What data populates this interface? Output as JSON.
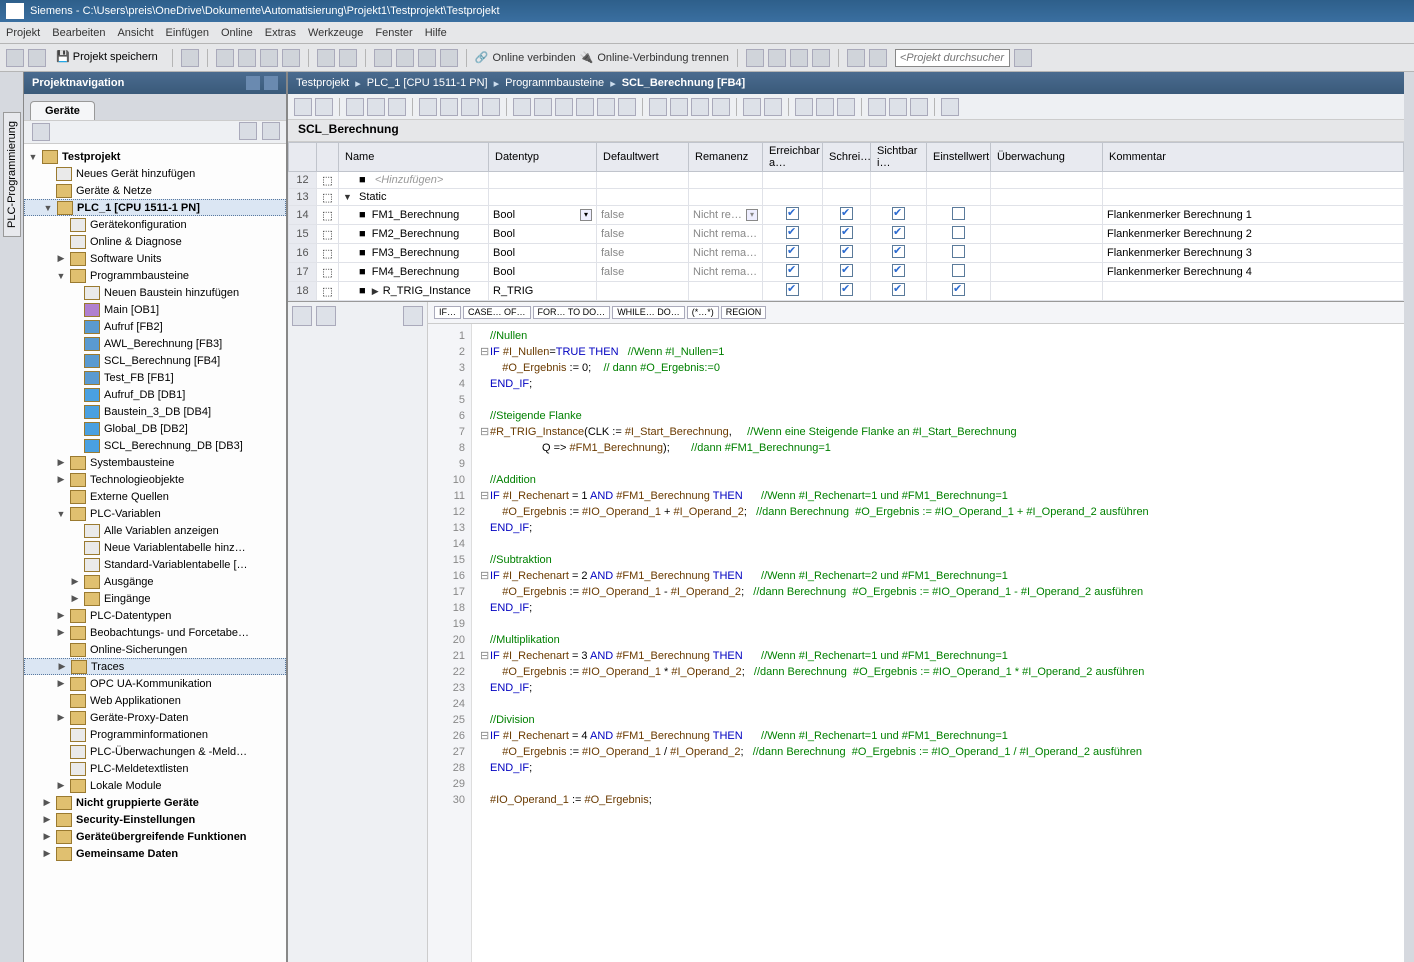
{
  "title": "Siemens  -  C:\\Users\\preis\\OneDrive\\Dokumente\\Automatisierung\\Projekt1\\Testprojekt\\Testprojekt",
  "menu": [
    "Projekt",
    "Bearbeiten",
    "Ansicht",
    "Einfügen",
    "Online",
    "Extras",
    "Werkzeuge",
    "Fenster",
    "Hilfe"
  ],
  "toolbar": {
    "save_label": "Projekt speichern",
    "online_verbinden": "Online verbinden",
    "online_trennen": "Online-Verbindung trennen",
    "search_placeholder": "<Projekt durchsucher"
  },
  "nav": {
    "header": "Projektnavigation",
    "tab": "Geräte"
  },
  "tree": [
    {
      "ind": 0,
      "exp": "▼",
      "icon": "folder",
      "label": "Testprojekt",
      "bold": true
    },
    {
      "ind": 1,
      "exp": "",
      "icon": "add",
      "label": "Neues Gerät hinzufügen"
    },
    {
      "ind": 1,
      "exp": "",
      "icon": "folder",
      "label": "Geräte & Netze"
    },
    {
      "ind": 1,
      "exp": "▼",
      "icon": "folder",
      "label": "PLC_1 [CPU 1511-1 PN]",
      "bold": true,
      "sel": true
    },
    {
      "ind": 2,
      "exp": "",
      "icon": "add",
      "label": "Gerätekonfiguration"
    },
    {
      "ind": 2,
      "exp": "",
      "icon": "add",
      "label": "Online & Diagnose"
    },
    {
      "ind": 2,
      "exp": "▶",
      "icon": "folder",
      "label": "Software Units"
    },
    {
      "ind": 2,
      "exp": "▼",
      "icon": "folder",
      "label": "Programmbausteine"
    },
    {
      "ind": 3,
      "exp": "",
      "icon": "add",
      "label": "Neuen Baustein hinzufügen"
    },
    {
      "ind": 3,
      "exp": "",
      "icon": "ob",
      "label": "Main [OB1]"
    },
    {
      "ind": 3,
      "exp": "",
      "icon": "fb",
      "label": "Aufruf [FB2]"
    },
    {
      "ind": 3,
      "exp": "",
      "icon": "fb",
      "label": "AWL_Berechnung [FB3]"
    },
    {
      "ind": 3,
      "exp": "",
      "icon": "fb",
      "label": "SCL_Berechnung [FB4]"
    },
    {
      "ind": 3,
      "exp": "",
      "icon": "fb",
      "label": "Test_FB [FB1]"
    },
    {
      "ind": 3,
      "exp": "",
      "icon": "db",
      "label": "Aufruf_DB [DB1]"
    },
    {
      "ind": 3,
      "exp": "",
      "icon": "db",
      "label": "Baustein_3_DB [DB4]"
    },
    {
      "ind": 3,
      "exp": "",
      "icon": "db",
      "label": "Global_DB [DB2]"
    },
    {
      "ind": 3,
      "exp": "",
      "icon": "db",
      "label": "SCL_Berechnung_DB [DB3]"
    },
    {
      "ind": 2,
      "exp": "▶",
      "icon": "folder",
      "label": "Systembausteine"
    },
    {
      "ind": 2,
      "exp": "▶",
      "icon": "folder",
      "label": "Technologieobjekte"
    },
    {
      "ind": 2,
      "exp": "",
      "icon": "folder",
      "label": "Externe Quellen"
    },
    {
      "ind": 2,
      "exp": "▼",
      "icon": "folder",
      "label": "PLC-Variablen"
    },
    {
      "ind": 3,
      "exp": "",
      "icon": "add",
      "label": "Alle Variablen anzeigen"
    },
    {
      "ind": 3,
      "exp": "",
      "icon": "add",
      "label": "Neue Variablentabelle hinz…"
    },
    {
      "ind": 3,
      "exp": "",
      "icon": "add",
      "label": "Standard-Variablentabelle […"
    },
    {
      "ind": 3,
      "exp": "▶",
      "icon": "folder",
      "label": "Ausgänge"
    },
    {
      "ind": 3,
      "exp": "▶",
      "icon": "folder",
      "label": "Eingänge"
    },
    {
      "ind": 2,
      "exp": "▶",
      "icon": "folder",
      "label": "PLC-Datentypen"
    },
    {
      "ind": 2,
      "exp": "▶",
      "icon": "folder",
      "label": "Beobachtungs- und Forcetabe…"
    },
    {
      "ind": 2,
      "exp": "",
      "icon": "folder",
      "label": "Online-Sicherungen"
    },
    {
      "ind": 2,
      "exp": "▶",
      "icon": "folder",
      "label": "Traces",
      "sel": true
    },
    {
      "ind": 2,
      "exp": "▶",
      "icon": "folder",
      "label": "OPC UA-Kommunikation"
    },
    {
      "ind": 2,
      "exp": "",
      "icon": "folder",
      "label": "Web Applikationen"
    },
    {
      "ind": 2,
      "exp": "▶",
      "icon": "folder",
      "label": "Geräte-Proxy-Daten"
    },
    {
      "ind": 2,
      "exp": "",
      "icon": "add",
      "label": "Programminformationen"
    },
    {
      "ind": 2,
      "exp": "",
      "icon": "add",
      "label": "PLC-Überwachungen & -Meld…"
    },
    {
      "ind": 2,
      "exp": "",
      "icon": "add",
      "label": "PLC-Meldetextlisten"
    },
    {
      "ind": 2,
      "exp": "▶",
      "icon": "folder",
      "label": "Lokale Module"
    },
    {
      "ind": 1,
      "exp": "▶",
      "icon": "folder",
      "label": "Nicht gruppierte Geräte",
      "bold": true
    },
    {
      "ind": 1,
      "exp": "▶",
      "icon": "folder",
      "label": "Security-Einstellungen",
      "bold": true
    },
    {
      "ind": 1,
      "exp": "▶",
      "icon": "folder",
      "label": "Geräteübergreifende Funktionen",
      "bold": true
    },
    {
      "ind": 1,
      "exp": "▶",
      "icon": "folder",
      "label": "Gemeinsame Daten",
      "bold": true
    }
  ],
  "breadcrumb": [
    "Testprojekt",
    "PLC_1 [CPU 1511-1 PN]",
    "Programmbausteine",
    "SCL_Berechnung [FB4]"
  ],
  "block_title": "SCL_Berechnung",
  "var_columns": [
    "",
    "Name",
    "Datentyp",
    "Defaultwert",
    "Remanenz",
    "Erreichbar a…",
    "Schrei…",
    "Sichtbar i…",
    "Einstellwert",
    "Überwachung",
    "Kommentar"
  ],
  "var_rows": [
    {
      "n": 12,
      "name": "<Hinzufügen>",
      "hinzu": true
    },
    {
      "n": 13,
      "name": "Static",
      "section": true
    },
    {
      "n": 14,
      "name": "FM1_Berechnung",
      "dt": "Bool",
      "dv": "false",
      "rem": "Nicht re…",
      "dd": true,
      "c1": true,
      "c2": true,
      "c3": true,
      "c4": false,
      "kom": "Flankenmerker Berechnung 1"
    },
    {
      "n": 15,
      "name": "FM2_Berechnung",
      "dt": "Bool",
      "dv": "false",
      "rem": "Nicht rema…",
      "c1": true,
      "c2": true,
      "c3": true,
      "c4": false,
      "kom": "Flankenmerker Berechnung 2"
    },
    {
      "n": 16,
      "name": "FM3_Berechnung",
      "dt": "Bool",
      "dv": "false",
      "rem": "Nicht rema…",
      "c1": true,
      "c2": true,
      "c3": true,
      "c4": false,
      "kom": "Flankenmerker Berechnung 3"
    },
    {
      "n": 17,
      "name": "FM4_Berechnung",
      "dt": "Bool",
      "dv": "false",
      "rem": "Nicht rema…",
      "c1": true,
      "c2": true,
      "c3": true,
      "c4": false,
      "kom": "Flankenmerker Berechnung 4"
    },
    {
      "n": 18,
      "name": "R_TRIG_Instance",
      "dt": "R_TRIG",
      "exp": true,
      "c1": true,
      "c2": true,
      "c3": true,
      "c4": true
    }
  ],
  "snippets": [
    "IF…",
    "CASE… OF…",
    "FOR… TO DO…",
    "WHILE… DO…",
    "(*…*)",
    "REGION"
  ],
  "code": [
    {
      "n": 1,
      "html": "<span class='cm'>//Nullen</span>"
    },
    {
      "n": 2,
      "fold": "⊟",
      "html": "<span class='kw'>IF</span> <span class='var'>#I_Nullen</span>=<span class='kw'>TRUE</span> <span class='kw'>THEN</span>   <span class='cm'>//Wenn #I_Nullen=1</span>"
    },
    {
      "n": 3,
      "html": "    <span class='var'>#O_Ergebnis</span> := 0;    <span class='cm'>// dann #O_Ergebnis:=0</span>"
    },
    {
      "n": 4,
      "html": "<span class='kw'>END_IF</span>;"
    },
    {
      "n": 5,
      "html": ""
    },
    {
      "n": 6,
      "html": "<span class='cm'>//Steigende Flanke</span>"
    },
    {
      "n": 7,
      "fold": "⊟",
      "html": "<span class='var'>#R_TRIG_Instance</span>(CLK := <span class='var'>#I_Start_Berechnung</span>,     <span class='cm'>//Wenn eine Steigende Flanke an #I_Start_Berechnung</span>"
    },
    {
      "n": 8,
      "html": "                 Q =&gt; <span class='var'>#FM1_Berechnung</span>);       <span class='cm'>//dann #FM1_Berechnung=1</span>"
    },
    {
      "n": 9,
      "html": ""
    },
    {
      "n": 10,
      "html": "<span class='cm'>//Addition</span>"
    },
    {
      "n": 11,
      "fold": "⊟",
      "html": "<span class='kw'>IF</span> <span class='var'>#I_Rechenart</span> = 1 <span class='kw'>AND</span> <span class='var'>#FM1_Berechnung</span> <span class='kw'>THEN</span>      <span class='cm'>//Wenn #I_Rechenart=1 und #FM1_Berechnung=1</span>"
    },
    {
      "n": 12,
      "html": "    <span class='var'>#O_Ergebnis</span> := <span class='var'>#IO_Operand_1</span> + <span class='var'>#I_Operand_2</span>;   <span class='cm'>//dann Berechnung  #O_Ergebnis := #IO_Operand_1 + #I_Operand_2 ausführen</span>"
    },
    {
      "n": 13,
      "html": "<span class='kw'>END_IF</span>;"
    },
    {
      "n": 14,
      "html": ""
    },
    {
      "n": 15,
      "html": "<span class='cm'>//Subtraktion</span>"
    },
    {
      "n": 16,
      "fold": "⊟",
      "html": "<span class='kw'>IF</span> <span class='var'>#I_Rechenart</span> = 2 <span class='kw'>AND</span> <span class='var'>#FM1_Berechnung</span> <span class='kw'>THEN</span>      <span class='cm'>//Wenn #I_Rechenart=2 und #FM1_Berechnung=1</span>"
    },
    {
      "n": 17,
      "html": "    <span class='var'>#O_Ergebnis</span> := <span class='var'>#IO_Operand_1</span> - <span class='var'>#I_Operand_2</span>;   <span class='cm'>//dann Berechnung  #O_Ergebnis := #IO_Operand_1 - #I_Operand_2 ausführen</span>"
    },
    {
      "n": 18,
      "html": "<span class='kw'>END_IF</span>;"
    },
    {
      "n": 19,
      "html": ""
    },
    {
      "n": 20,
      "html": "<span class='cm'>//Multiplikation</span>"
    },
    {
      "n": 21,
      "fold": "⊟",
      "html": "<span class='kw'>IF</span> <span class='var'>#I_Rechenart</span> = 3 <span class='kw'>AND</span> <span class='var'>#FM1_Berechnung</span> <span class='kw'>THEN</span>      <span class='cm'>//Wenn #I_Rechenart=1 und #FM1_Berechnung=1</span>"
    },
    {
      "n": 22,
      "html": "    <span class='var'>#O_Ergebnis</span> := <span class='var'>#IO_Operand_1</span> * <span class='var'>#I_Operand_2</span>;   <span class='cm'>//dann Berechnung  #O_Ergebnis := #IO_Operand_1 * #I_Operand_2 ausführen</span>"
    },
    {
      "n": 23,
      "html": "<span class='kw'>END_IF</span>;"
    },
    {
      "n": 24,
      "html": ""
    },
    {
      "n": 25,
      "html": "<span class='cm'>//Division</span>"
    },
    {
      "n": 26,
      "fold": "⊟",
      "html": "<span class='kw'>IF</span> <span class='var'>#I_Rechenart</span> = 4 <span class='kw'>AND</span> <span class='var'>#FM1_Berechnung</span> <span class='kw'>THEN</span>      <span class='cm'>//Wenn #I_Rechenart=1 und #FM1_Berechnung=1</span>"
    },
    {
      "n": 27,
      "html": "    <span class='var'>#O_Ergebnis</span> := <span class='var'>#IO_Operand_1</span> / <span class='var'>#I_Operand_2</span>;   <span class='cm'>//dann Berechnung  #O_Ergebnis := #IO_Operand_1 / #I_Operand_2 ausführen</span>"
    },
    {
      "n": 28,
      "html": "<span class='kw'>END_IF</span>;"
    },
    {
      "n": 29,
      "html": ""
    },
    {
      "n": 30,
      "html": "<span class='var'>#IO_Operand_1</span> := <span class='var'>#O_Ergebnis</span>;"
    }
  ]
}
